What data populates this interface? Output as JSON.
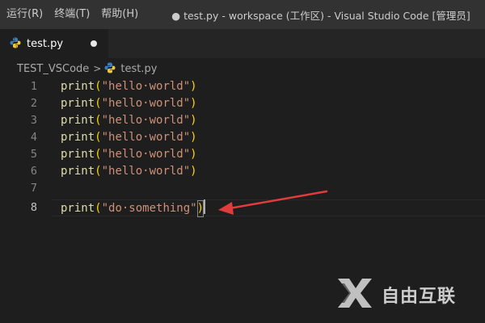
{
  "menu": {
    "items": [
      {
        "label": "运行(R)"
      },
      {
        "label": "终端(T)"
      },
      {
        "label": "帮助(H)"
      }
    ]
  },
  "window_title": "● test.py - workspace (工作区) - Visual Studio Code [管理员]",
  "tab": {
    "label": "test.py",
    "icon": "python-icon",
    "modified": true
  },
  "breadcrumb": {
    "folder": "TEST_VSCode",
    "separator": ">",
    "file": "test.py",
    "file_icon": "python-icon"
  },
  "editor": {
    "active_line": 8,
    "lines": [
      {
        "number": "1",
        "fn": "print",
        "open": "(",
        "str": "\"hello·world\"",
        "close": ")"
      },
      {
        "number": "2",
        "fn": "print",
        "open": "(",
        "str": "\"hello·world\"",
        "close": ")"
      },
      {
        "number": "3",
        "fn": "print",
        "open": "(",
        "str": "\"hello·world\"",
        "close": ")"
      },
      {
        "number": "4",
        "fn": "print",
        "open": "(",
        "str": "\"hello·world\"",
        "close": ")"
      },
      {
        "number": "5",
        "fn": "print",
        "open": "(",
        "str": "\"hello·world\"",
        "close": ")"
      },
      {
        "number": "6",
        "fn": "print",
        "open": "(",
        "str": "\"hello·world\"",
        "close": ")"
      },
      {
        "number": "7",
        "fn": "",
        "open": "",
        "str": "",
        "close": ""
      },
      {
        "number": "8",
        "fn": "print",
        "open": "(",
        "str": "\"do·something\"",
        "close": ")"
      }
    ]
  },
  "annotation": {
    "type": "red-arrow",
    "color": "#e03c3c"
  },
  "watermark": {
    "text": "自由互联",
    "logo": "x-logo-icon"
  },
  "colors": {
    "function": "#dcdcaa",
    "bracket": "#ffd700",
    "string": "#ce9178",
    "background": "#1e1e1e"
  }
}
